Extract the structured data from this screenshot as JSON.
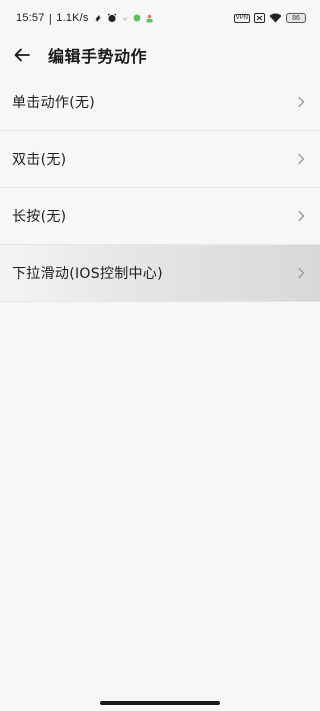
{
  "status_bar": {
    "time": "15:57",
    "separator": "|",
    "net_speed": "1.1K/s",
    "vpn_label": "VPN",
    "battery_level": "86",
    "icons": [
      "do-not-disturb-icon",
      "alarm-icon",
      "dot-icon",
      "green-dot-icon",
      "person-icon",
      "vpn-icon",
      "sim-x-icon",
      "wifi-icon",
      "battery-icon"
    ],
    "accent_green": "#5cc35c",
    "accent_pink": "#e57373"
  },
  "header": {
    "title": "编辑手势动作",
    "back_icon": "arrow-left-icon"
  },
  "list": {
    "items": [
      {
        "label": "单击动作(无)",
        "icon": "chevron-right-icon"
      },
      {
        "label": "双击(无)",
        "icon": "chevron-right-icon"
      },
      {
        "label": "长按(无)",
        "icon": "chevron-right-icon"
      },
      {
        "label": "下拉滑动(IOS控制中心)",
        "icon": "chevron-right-icon",
        "highlighted": true
      }
    ]
  }
}
